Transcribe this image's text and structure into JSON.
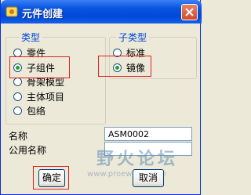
{
  "window": {
    "title": "元件创建"
  },
  "type_group": {
    "title": "类型",
    "options": [
      "零件",
      "子组件",
      "骨架模型",
      "主体项目",
      "包络"
    ],
    "selected": "子组件"
  },
  "subtype_group": {
    "title": "子类型",
    "options": [
      "标准",
      "镜像"
    ],
    "selected": "镜像"
  },
  "fields": {
    "name_label": "名称",
    "name_value": "ASM0002",
    "common_name_label": "公用名称",
    "common_name_value": ""
  },
  "buttons": {
    "ok": "确定",
    "cancel": "取消"
  },
  "watermark": {
    "title": "野火论坛",
    "url": "www.proewildfire.cn"
  },
  "colors": {
    "titlebar": "#0a55e0",
    "group_title": "#0046d5",
    "highlight": "#e02020",
    "radio_dot": "#21a121"
  }
}
